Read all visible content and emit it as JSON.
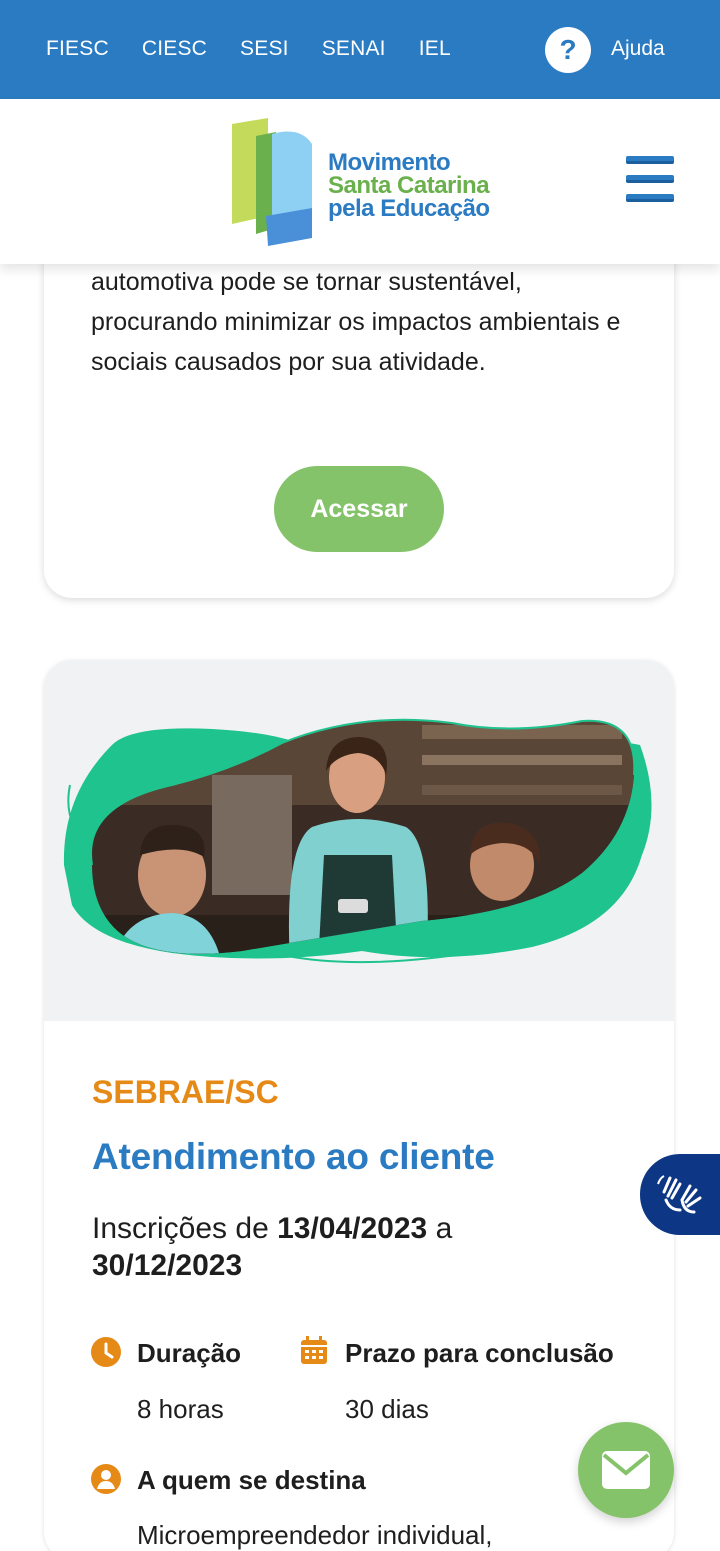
{
  "topbar": {
    "nav": [
      "FIESC",
      "CIESC",
      "SESI",
      "SENAI",
      "IEL"
    ],
    "help_symbol": "?",
    "help_label": "Ajuda"
  },
  "header": {
    "logo_lines": [
      "Movimento",
      "Santa Catarina",
      "pela Educação"
    ],
    "menu_icon": "hamburger-menu-icon"
  },
  "previous_card": {
    "description": "automotiva pode se tornar sustentável, procurando minimizar os impactos ambientais e sociais causados por sua atividade.",
    "button_label": "Acessar"
  },
  "course": {
    "provider": "SEBRAE/SC",
    "title": "Atendimento ao cliente",
    "dates_prefix": "Inscrições de",
    "start_date": "13/04/2023",
    "dates_connector": "a",
    "end_date": "30/12/2023",
    "duration_label": "Duração",
    "duration_value": "8 horas",
    "deadline_label": "Prazo para conclusão",
    "deadline_value": "30 dias",
    "audience_label": "A quem se destina",
    "audience_value": "Microempreendedor individual,"
  },
  "colors": {
    "brand_blue": "#2b7bc3",
    "brand_green": "#85c36a",
    "accent_orange": "#e58a17",
    "libras_navy": "#0d3784"
  },
  "icons": {
    "duration": "clock-icon",
    "deadline": "calendar-icon",
    "audience": "person-icon",
    "libras": "sign-language-hands-icon",
    "contact": "envelope-icon"
  }
}
